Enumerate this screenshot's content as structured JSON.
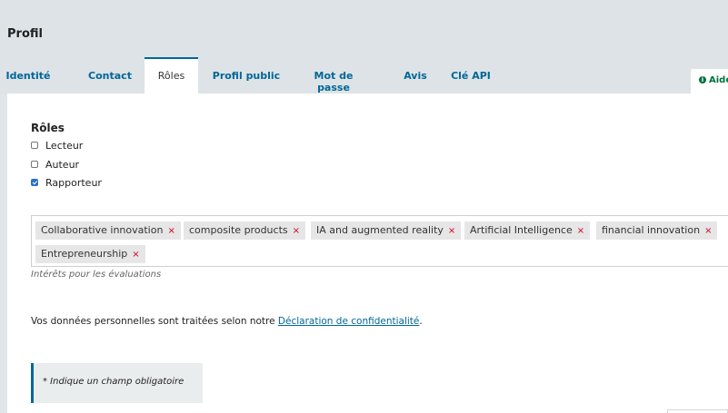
{
  "page": {
    "title": "Profil"
  },
  "tabs": [
    {
      "label": "Identité"
    },
    {
      "label": "Contact"
    },
    {
      "label": "Rôles"
    },
    {
      "label": "Profil public"
    },
    {
      "label": "Mot de passe"
    },
    {
      "label": "Avis"
    },
    {
      "label": "Clé API"
    }
  ],
  "active_tab": "Rôles",
  "help": {
    "label": "Aide"
  },
  "roles": {
    "title": "Rôles",
    "options": [
      {
        "label": "Lecteur",
        "checked": false
      },
      {
        "label": "Auteur",
        "checked": false
      },
      {
        "label": "Rapporteur",
        "checked": true
      }
    ]
  },
  "interests": {
    "tags": [
      "Collaborative innovation",
      "composite products",
      "IA and augmented reality",
      "Artificial Intelligence",
      "financial innovation",
      "Entrepreneurship"
    ],
    "remove_glyph": "×",
    "description": "Intérêts pour les évaluations"
  },
  "privacy": {
    "text": "Vos données personnelles sont traitées selon notre ",
    "link": "Déclaration de confidentialité",
    "suffix": "."
  },
  "required_note": "* Indique un champ obligatoire",
  "colors": {
    "accent": "#006798",
    "help_green": "#00703c",
    "remove_red": "#d0021b",
    "checkbox_blue": "#2a6fc9"
  }
}
